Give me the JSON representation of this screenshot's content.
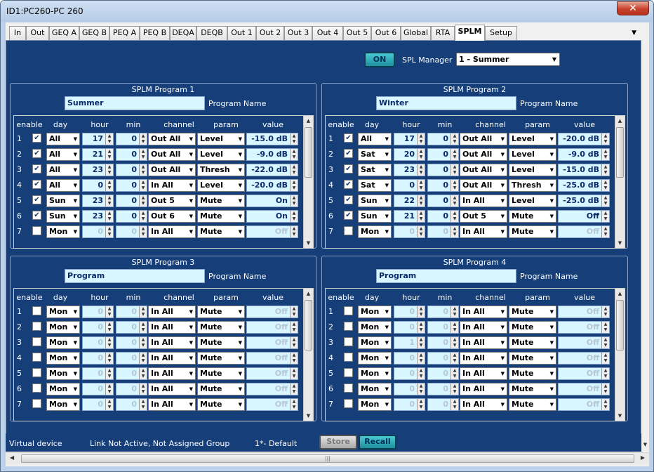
{
  "window": {
    "title": "ID1:PC260-PC 260",
    "close_label": "✕"
  },
  "tabs": [
    {
      "label": "In"
    },
    {
      "label": "Out"
    },
    {
      "label": "GEQ A"
    },
    {
      "label": "GEQ B"
    },
    {
      "label": "PEQ A"
    },
    {
      "label": "PEQ B"
    },
    {
      "label": "DEQA"
    },
    {
      "label": "DEQB"
    },
    {
      "label": "Out 1"
    },
    {
      "label": "Out 2"
    },
    {
      "label": "Out 3"
    },
    {
      "label": "Out 4"
    },
    {
      "label": "Out 5"
    },
    {
      "label": "Out 6"
    },
    {
      "label": "Global"
    },
    {
      "label": "RTA"
    },
    {
      "label": "SPLM"
    },
    {
      "label": "Setup"
    }
  ],
  "active_tab": "SPLM",
  "manager": {
    "on_label": "ON",
    "label": "SPL Manager",
    "selected": "1 - Summer"
  },
  "columns": [
    "enable",
    "day",
    "hour",
    "min",
    "channel",
    "param",
    "value"
  ],
  "program_name_label": "Program Name",
  "programs": [
    {
      "title": "SPLM Program 1",
      "name": "Summer",
      "rows": [
        {
          "n": "1",
          "en": true,
          "day": "All",
          "hour": "17",
          "min": "0",
          "ch": "Out All",
          "param": "Level",
          "value": "-15.0 dB",
          "dis": false
        },
        {
          "n": "2",
          "en": true,
          "day": "All",
          "hour": "21",
          "min": "0",
          "ch": "Out All",
          "param": "Level",
          "value": "-9.0 dB",
          "dis": false
        },
        {
          "n": "3",
          "en": true,
          "day": "All",
          "hour": "23",
          "min": "0",
          "ch": "Out All",
          "param": "Thresh",
          "value": "-22.0 dB",
          "dis": false
        },
        {
          "n": "4",
          "en": true,
          "day": "All",
          "hour": "0",
          "min": "0",
          "ch": "In All",
          "param": "Level",
          "value": "-20.0 dB",
          "dis": false
        },
        {
          "n": "5",
          "en": true,
          "day": "Sun",
          "hour": "23",
          "min": "0",
          "ch": "Out 5",
          "param": "Mute",
          "value": "On",
          "dis": false
        },
        {
          "n": "6",
          "en": true,
          "day": "Sun",
          "hour": "23",
          "min": "0",
          "ch": "Out 6",
          "param": "Mute",
          "value": "On",
          "dis": false
        },
        {
          "n": "7",
          "en": false,
          "day": "Mon",
          "hour": "0",
          "min": "0",
          "ch": "In All",
          "param": "Mute",
          "value": "Off",
          "dis": true
        }
      ]
    },
    {
      "title": "SPLM Program 2",
      "name": "Winter",
      "rows": [
        {
          "n": "1",
          "en": true,
          "day": "All",
          "hour": "17",
          "min": "0",
          "ch": "Out All",
          "param": "Level",
          "value": "-20.0 dB",
          "dis": false
        },
        {
          "n": "2",
          "en": true,
          "day": "Sat",
          "hour": "20",
          "min": "0",
          "ch": "Out All",
          "param": "Level",
          "value": "-9.0 dB",
          "dis": false
        },
        {
          "n": "3",
          "en": true,
          "day": "Sat",
          "hour": "23",
          "min": "0",
          "ch": "Out All",
          "param": "Level",
          "value": "-15.0 dB",
          "dis": false
        },
        {
          "n": "4",
          "en": true,
          "day": "Sat",
          "hour": "0",
          "min": "0",
          "ch": "Out All",
          "param": "Thresh",
          "value": "-25.0 dB",
          "dis": false
        },
        {
          "n": "5",
          "en": true,
          "day": "Sun",
          "hour": "22",
          "min": "0",
          "ch": "In All",
          "param": "Level",
          "value": "-25.0 dB",
          "dis": false
        },
        {
          "n": "6",
          "en": true,
          "day": "Sun",
          "hour": "21",
          "min": "0",
          "ch": "Out 5",
          "param": "Mute",
          "value": "Off",
          "dis": false
        },
        {
          "n": "7",
          "en": false,
          "day": "Mon",
          "hour": "0",
          "min": "0",
          "ch": "In All",
          "param": "Mute",
          "value": "Off",
          "dis": true
        }
      ]
    },
    {
      "title": "SPLM Program 3",
      "name": "Program",
      "rows": [
        {
          "n": "1",
          "en": false,
          "day": "Mon",
          "hour": "0",
          "min": "0",
          "ch": "In All",
          "param": "Mute",
          "value": "Off",
          "dis": true
        },
        {
          "n": "2",
          "en": false,
          "day": "Mon",
          "hour": "0",
          "min": "0",
          "ch": "In All",
          "param": "Mute",
          "value": "Off",
          "dis": true
        },
        {
          "n": "3",
          "en": false,
          "day": "Mon",
          "hour": "0",
          "min": "0",
          "ch": "In All",
          "param": "Mute",
          "value": "Off",
          "dis": true
        },
        {
          "n": "4",
          "en": false,
          "day": "Mon",
          "hour": "0",
          "min": "0",
          "ch": "In All",
          "param": "Mute",
          "value": "Off",
          "dis": true
        },
        {
          "n": "5",
          "en": false,
          "day": "Mon",
          "hour": "0",
          "min": "0",
          "ch": "In All",
          "param": "Mute",
          "value": "Off",
          "dis": true
        },
        {
          "n": "6",
          "en": false,
          "day": "Mon",
          "hour": "0",
          "min": "0",
          "ch": "In All",
          "param": "Mute",
          "value": "Off",
          "dis": true
        },
        {
          "n": "7",
          "en": false,
          "day": "Mon",
          "hour": "0",
          "min": "0",
          "ch": "In All",
          "param": "Mute",
          "value": "Off",
          "dis": true
        }
      ]
    },
    {
      "title": "SPLM Program 4",
      "name": "Program",
      "rows": [
        {
          "n": "1",
          "en": false,
          "day": "Mon",
          "hour": "0",
          "min": "0",
          "ch": "In All",
          "param": "Mute",
          "value": "Off",
          "dis": true
        },
        {
          "n": "2",
          "en": false,
          "day": "Mon",
          "hour": "0",
          "min": "0",
          "ch": "In All",
          "param": "Mute",
          "value": "Off",
          "dis": true
        },
        {
          "n": "3",
          "en": false,
          "day": "Mon",
          "hour": "1",
          "min": "0",
          "ch": "In All",
          "param": "Mute",
          "value": "Off",
          "dis": true
        },
        {
          "n": "4",
          "en": false,
          "day": "Mon",
          "hour": "0",
          "min": "0",
          "ch": "In All",
          "param": "Mute",
          "value": "Off",
          "dis": true
        },
        {
          "n": "5",
          "en": false,
          "day": "Mon",
          "hour": "0",
          "min": "0",
          "ch": "In All",
          "param": "Mute",
          "value": "Off",
          "dis": true
        },
        {
          "n": "6",
          "en": false,
          "day": "Mon",
          "hour": "0",
          "min": "0",
          "ch": "In All",
          "param": "Mute",
          "value": "Off",
          "dis": true
        },
        {
          "n": "7",
          "en": false,
          "day": "Mon",
          "hour": "0",
          "min": "0",
          "ch": "In All",
          "param": "Mute",
          "value": "Off",
          "dis": true
        }
      ]
    }
  ],
  "status": {
    "device": "Virtual device",
    "link": "Link Not Active,  Not Assigned Group",
    "preset": "1*- Default",
    "store_label": "Store",
    "recall_label": "Recall"
  },
  "icons": {
    "check": "check-icon",
    "dropdown": "chevron-down-icon",
    "spin": "spinner-arrows-icon"
  },
  "colors": {
    "panel": "#163f7a",
    "field": "#d8f6ff",
    "accent": "#1f8f9c",
    "close": "#c7402b"
  }
}
